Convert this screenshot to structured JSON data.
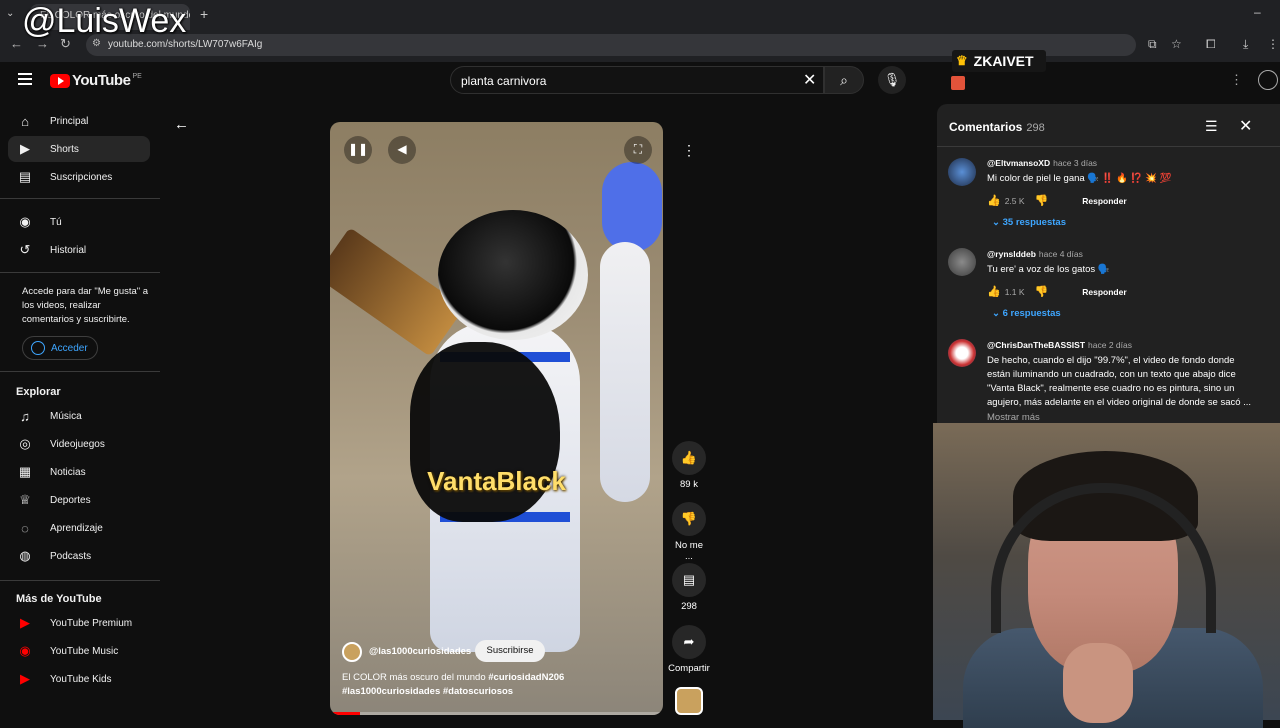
{
  "watermark": "@LuisWex",
  "browser": {
    "tab_title": "EL COLOR más oscuro del mundo",
    "url": "youtube.com/shorts/LW707w6FAIg"
  },
  "youtube": {
    "logo_text": "YouTube",
    "region": "PE",
    "search_value": "planta carnivora",
    "sidebar": {
      "main": [
        {
          "label": "Principal",
          "icon": "home-icon"
        },
        {
          "label": "Shorts",
          "icon": "shorts-icon"
        },
        {
          "label": "Suscripciones",
          "icon": "subscriptions-icon"
        }
      ],
      "you": [
        {
          "label": "Tú",
          "icon": "you-icon"
        },
        {
          "label": "Historial",
          "icon": "history-icon"
        }
      ],
      "signin_text": "Accede para dar \"Me gusta\" a los videos, realizar comentarios y suscribirte.",
      "signin_button": "Acceder",
      "explore_title": "Explorar",
      "explore": [
        {
          "label": "Música",
          "icon": "music-icon"
        },
        {
          "label": "Videojuegos",
          "icon": "gaming-icon"
        },
        {
          "label": "Noticias",
          "icon": "news-icon"
        },
        {
          "label": "Deportes",
          "icon": "trophy-icon"
        },
        {
          "label": "Aprendizaje",
          "icon": "lightbulb-icon"
        },
        {
          "label": "Podcasts",
          "icon": "podcast-icon"
        }
      ],
      "more_title": "Más de YouTube",
      "more": [
        {
          "label": "YouTube Premium"
        },
        {
          "label": "YouTube Music"
        },
        {
          "label": "YouTube Kids"
        }
      ]
    },
    "short": {
      "overlay_text": "VantaBlack",
      "channel": "@las1000curiosidades",
      "subscribe": "Suscribirse",
      "title_plain": "El COLOR más oscuro del mundo",
      "title_tags_1": "#curiosidadN206",
      "title_tags_2": "#las1000curiosidades #datoscuriosos",
      "likes": "89 k",
      "dislike_label": "No me ...",
      "comments": "298",
      "share": "Compartir"
    },
    "comments_panel": {
      "title": "Comentarios",
      "count": "298",
      "items": [
        {
          "user": "@EltvmansoXD",
          "time": "hace 3 días",
          "text": "Mi color de piel le gana 🗣️ ‼️ 🔥 ⁉️ 💥 💯",
          "likes": "2.5 K",
          "reply": "Responder",
          "replies": "35 respuestas"
        },
        {
          "user": "@rynslddeb",
          "time": "hace 4 días",
          "text": "Tu ere' a voz de los gatos 🗣️",
          "likes": "1.1 K",
          "reply": "Responder",
          "replies": "6 respuestas"
        },
        {
          "user": "@ChrisDanTheBASSIST",
          "time": "hace 2 días",
          "text": "De hecho, cuando el dijo \"99.7%\", el video de fondo donde están iluminando un cuadrado, con un texto que abajo dice \"Vanta Black\", realmente ese cuadro no es pintura, sino un agujero, más adelante en el video original de donde se sacó ...",
          "more": "Mostrar más"
        }
      ]
    }
  },
  "streamer_badge": "ZKAIVET",
  "colors": {
    "accent_red": "#ff0000",
    "link_blue": "#3ea6ff"
  }
}
